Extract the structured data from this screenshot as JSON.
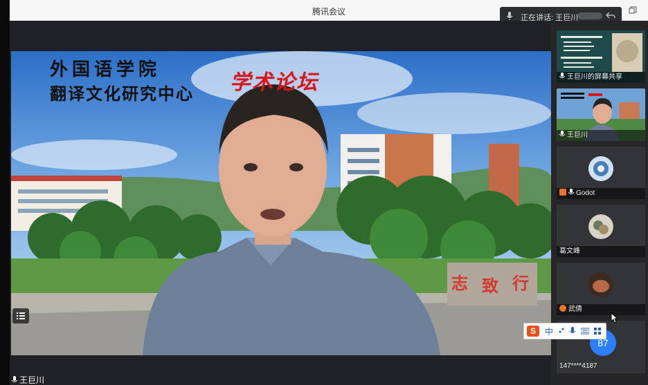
{
  "window": {
    "title": "腾讯会议"
  },
  "speaking": {
    "text": "正在讲话: 王巨川",
    "icon": "mic-icon"
  },
  "main_video": {
    "speaker_name": "王巨川",
    "background_text": {
      "line1": "外国语学院",
      "line2": "翻译文化研究中心",
      "forum": "学术论坛",
      "stone_chars": "志 致 行"
    }
  },
  "participants": [
    {
      "name": "王巨川的屏幕共享",
      "type": "screen-share"
    },
    {
      "name": "王巨川",
      "type": "video"
    },
    {
      "name": "Godot",
      "type": "avatar"
    },
    {
      "name": "葛文峰",
      "type": "avatar"
    },
    {
      "name": "武倩",
      "type": "avatar"
    }
  ],
  "participant_count": "87",
  "phone_participant": "147****4187",
  "ime_toolbar": {
    "logo": "S",
    "mode": "中",
    "icons": [
      "punctuation-icon",
      "mic-icon",
      "keyboard-icon",
      "toolbox-icon"
    ]
  },
  "colors": {
    "accent_blue": "#2d7ff9",
    "forum_red": "#d8161b",
    "ime_orange": "#e8501a"
  }
}
